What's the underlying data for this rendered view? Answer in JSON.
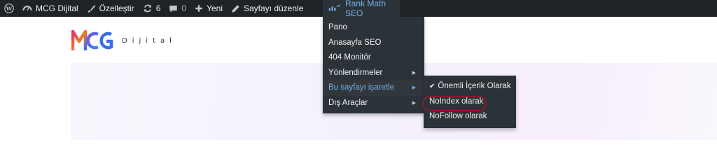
{
  "adminbar": {
    "site_name": "MCG Dijital",
    "customize": "Özelleştir",
    "updates_count": "6",
    "comments_count": "0",
    "new": "Yeni",
    "edit_page": "Sayfayı düzenle",
    "rankmath": "Rank Math SEO"
  },
  "logo": {
    "mark": "MCG",
    "text": "Dijital"
  },
  "rankmath_menu": {
    "items": [
      {
        "label": "Pano"
      },
      {
        "label": "Anasayfa SEO"
      },
      {
        "label": "404 Monitör"
      },
      {
        "label": "Yönlendirmeler"
      },
      {
        "label": "Bu sayfayı işaretle"
      },
      {
        "label": "Dış Araçlar"
      }
    ]
  },
  "mark_submenu": {
    "items": [
      {
        "label": "Önemli İçerik Olarak",
        "checked": true
      },
      {
        "label": "NoIndex olarak"
      },
      {
        "label": "NoFollow olarak"
      }
    ]
  },
  "colors": {
    "adminbar_bg": "#1d2327",
    "menu_bg": "#2c3338",
    "accent": "#72aee6",
    "annotation": "#8b1a2b"
  }
}
